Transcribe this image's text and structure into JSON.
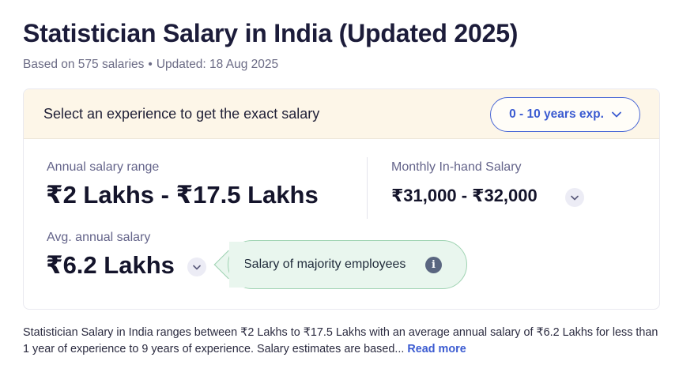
{
  "page": {
    "title": "Statistician Salary in India (Updated 2025)",
    "meta_salaries": "Based on 575 salaries",
    "meta_separator": "•",
    "meta_updated": "Updated: 18 Aug 2025"
  },
  "experience": {
    "prompt": "Select an experience to get the exact salary",
    "selected": "0 - 10 years exp."
  },
  "salary": {
    "annual_range_label": "Annual salary range",
    "annual_range_value": "₹2 Lakhs - ₹17.5 Lakhs",
    "monthly_label": "Monthly In-hand Salary",
    "monthly_value": "₹31,000 - ₹32,000",
    "avg_label": "Avg. annual salary",
    "avg_value": "₹6.2 Lakhs"
  },
  "tooltip": {
    "text": "Salary of majority employees",
    "info_glyph": "i"
  },
  "description": {
    "text": "Statistician Salary in India ranges between ₹2 Lakhs to ₹17.5 Lakhs with an average annual salary of ₹6.2 Lakhs for less than 1 year of experience to 9 years of experience. Salary estimates are based... ",
    "read_more": "Read more"
  },
  "colors": {
    "accent": "#3b5bd1",
    "header_bg": "#fdf6e8",
    "tooltip_bg": "#e9f6ee",
    "tooltip_border": "#9fd3b2"
  },
  "icons": {
    "dropdown": "chevron-down-icon",
    "info": "info-icon"
  }
}
